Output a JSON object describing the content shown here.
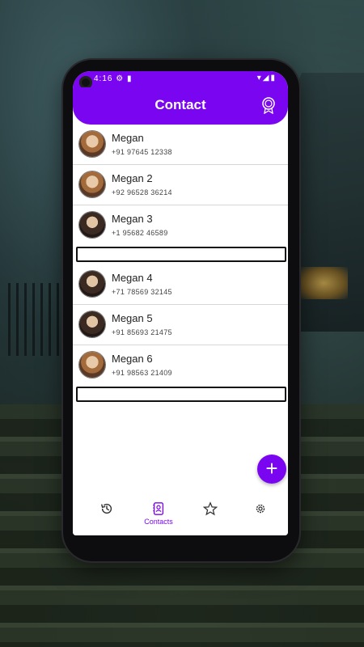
{
  "status": {
    "left": "4:16 ⚙ ▮",
    "right": "▾◢▮"
  },
  "app_bar": {
    "title": "Contact",
    "action_icon": "badge-icon"
  },
  "contacts": [
    {
      "name": "Megan",
      "phone": "+91 97645 12338"
    },
    {
      "name": "Megan 2",
      "phone": "+92 96528 36214"
    },
    {
      "name": "Megan 3",
      "phone": "+1 95682 46589"
    },
    {
      "name": "Megan 4",
      "phone": "+71 78569 32145"
    },
    {
      "name": "Megan 5",
      "phone": "+91 85693 21475"
    },
    {
      "name": "Megan 6",
      "phone": "+91 98563 21409"
    }
  ],
  "fab": {
    "label": "+",
    "icon": "add-icon"
  },
  "bottom_nav": {
    "items": [
      {
        "icon": "history-icon",
        "label": ""
      },
      {
        "icon": "contacts-icon",
        "label": "Contacts"
      },
      {
        "icon": "star-icon",
        "label": ""
      },
      {
        "icon": "gear-icon",
        "label": ""
      }
    ],
    "active": "Contacts"
  },
  "colors": {
    "accent": "#7a05f0",
    "text": "#222222"
  }
}
